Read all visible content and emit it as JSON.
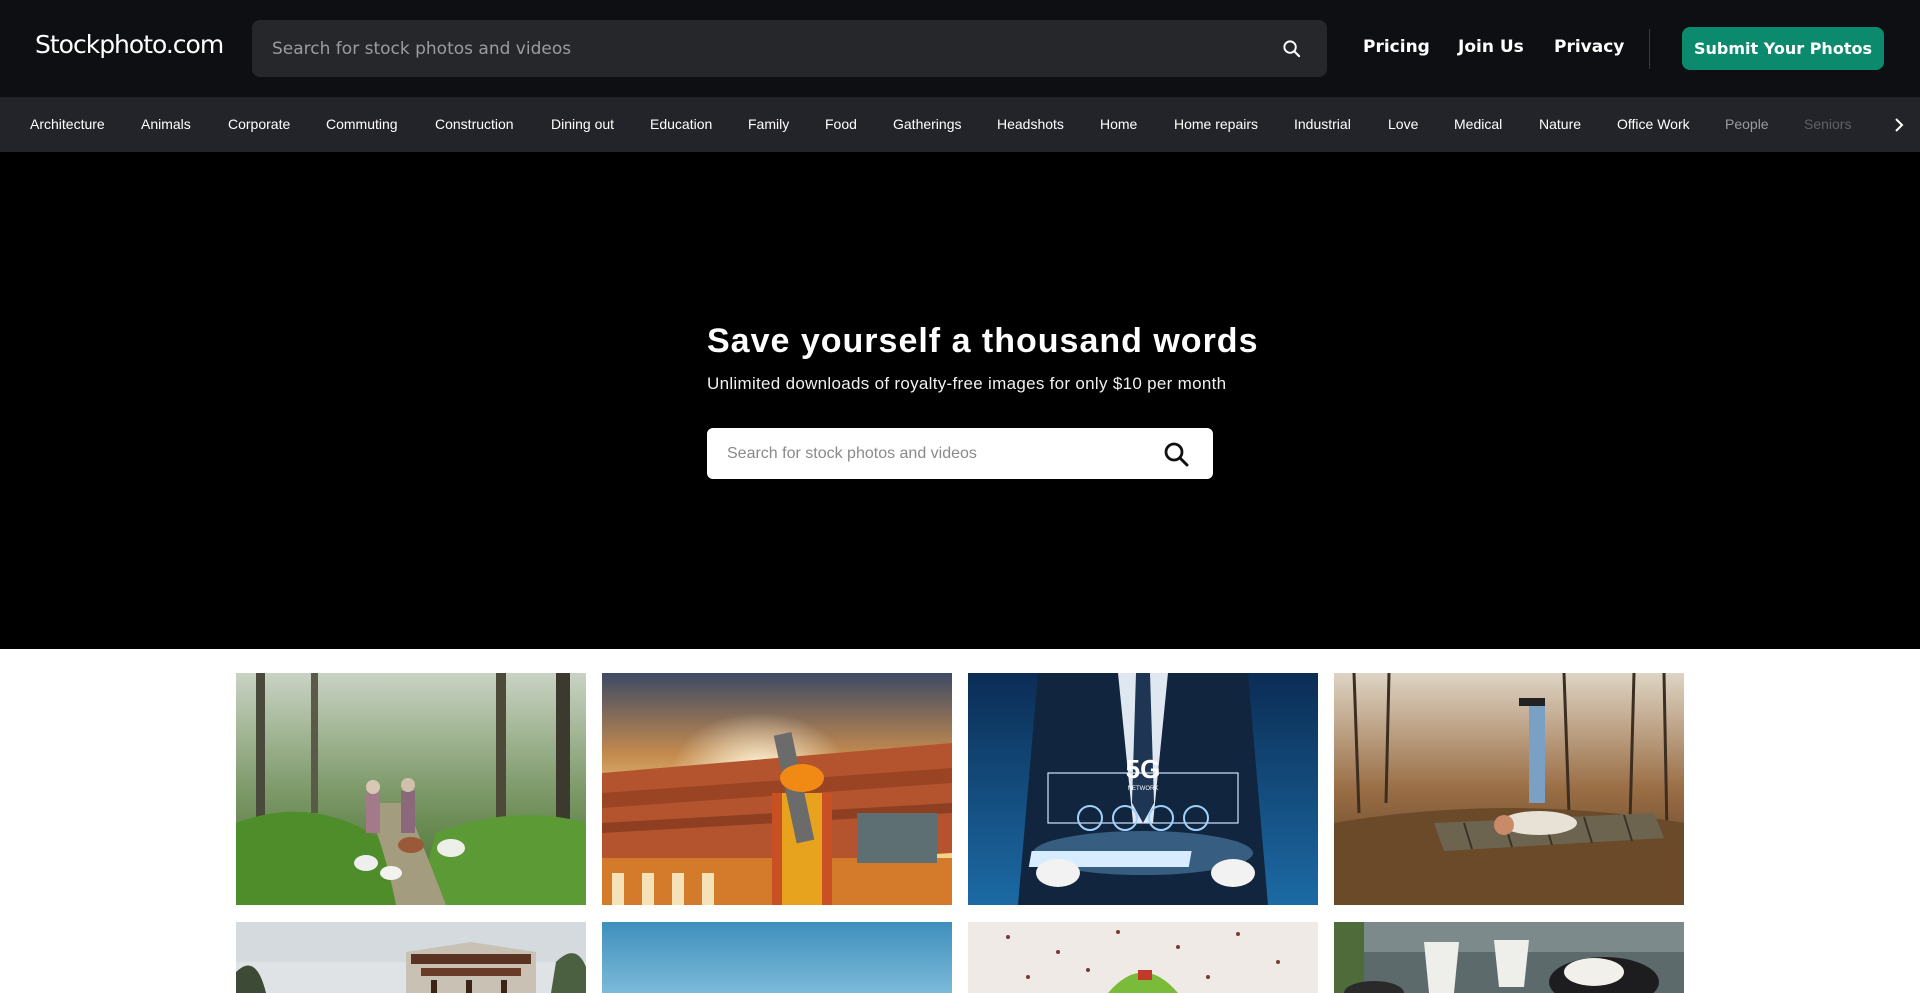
{
  "header": {
    "logo": "Stockphoto.com",
    "search_placeholder": "Search for stock photos and videos",
    "nav": [
      "Pricing",
      "Join Us",
      "Privacy"
    ],
    "submit_label": "Submit Your Photos",
    "accent_color": "#0c8a6e"
  },
  "categories": [
    "Architecture",
    "Animals",
    "Corporate",
    "Commuting",
    "Construction",
    "Dining out",
    "Education",
    "Family",
    "Food",
    "Gatherings",
    "Headshots",
    "Home",
    "Home repairs",
    "Industrial",
    "Love",
    "Medical",
    "Nature",
    "Office Work",
    "People",
    "Seniors"
  ],
  "hero": {
    "title": "Save yourself a thousand words",
    "subtitle": "Unlimited downloads of royalty-free images for only $10 per month",
    "search_placeholder": "Search for stock photos and videos"
  },
  "photo_texts": {
    "five_g": "5G",
    "network": "NETWORK"
  }
}
